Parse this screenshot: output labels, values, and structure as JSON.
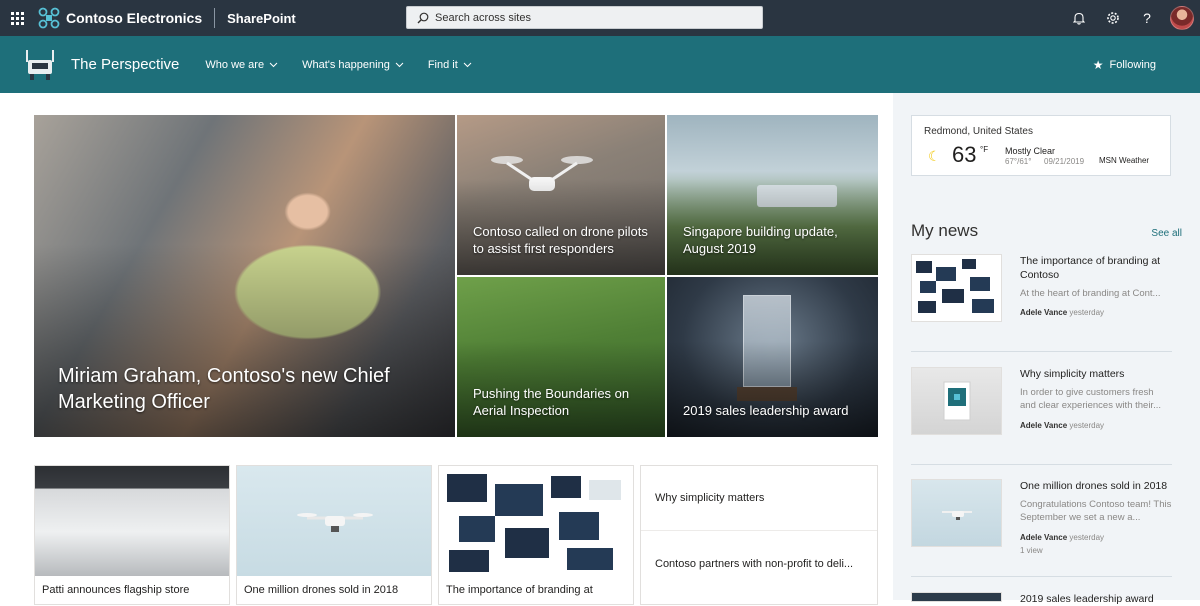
{
  "suite": {
    "brand": "Contoso Electronics",
    "app": "SharePoint",
    "search_placeholder": "Search across sites"
  },
  "site": {
    "title": "The Perspective",
    "nav": [
      "Who we are",
      "What's happening",
      "Find it"
    ],
    "following": "Following"
  },
  "hero": {
    "main": "Miriam Graham, Contoso's new Chief Marketing Officer",
    "t2": "Contoso called on drone pilots to assist first responders",
    "t3": "Singapore building update, August 2019",
    "t4": "Pushing the Boundaries on Aerial Inspection",
    "t5": "2019 sales leadership award"
  },
  "cards": {
    "c1": "Patti announces flagship store",
    "c2": "One million drones sold in 2018",
    "c3": "The importance of branding at",
    "list": [
      "Why simplicity matters",
      "Contoso partners with non-profit to deli..."
    ]
  },
  "weather": {
    "location": "Redmond, United States",
    "temp": "63",
    "unit": "°F",
    "condition": "Mostly Clear",
    "hilo": "67°/61°",
    "date": "09/21/2019",
    "source": "MSN Weather"
  },
  "mynews": {
    "title": "My news",
    "see_all": "See all",
    "items": [
      {
        "title": "The importance of branding at Contoso",
        "desc": "At the heart of branding at Cont...",
        "author": "Adele Vance",
        "when": "yesterday"
      },
      {
        "title": "Why simplicity matters",
        "desc": "In order to give customers fresh and clear experiences with their...",
        "author": "Adele Vance",
        "when": "yesterday"
      },
      {
        "title": "One million drones sold in 2018",
        "desc": "Congratulations Contoso team! This September we set a new a...",
        "author": "Adele Vance",
        "when": "yesterday",
        "views": "1 view"
      },
      {
        "title": "2019 sales leadership award"
      }
    ]
  }
}
